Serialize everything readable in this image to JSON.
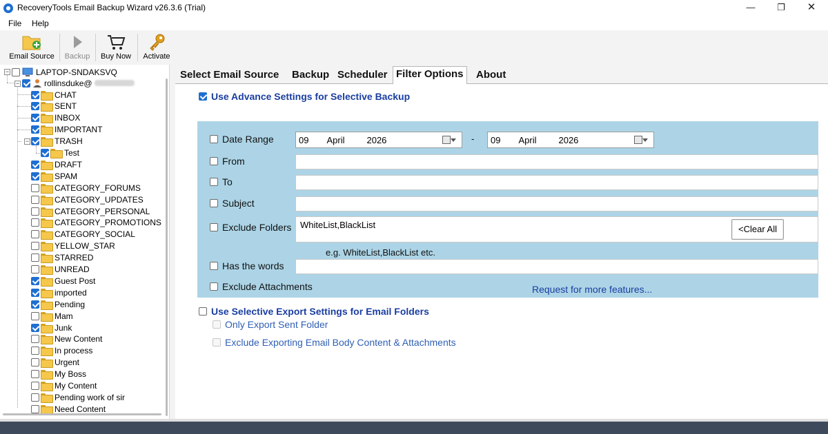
{
  "window": {
    "title": "RecoveryTools Email Backup Wizard v26.3.6 (Trial)",
    "min": "—",
    "max": "❐",
    "close": "✕"
  },
  "menu": {
    "file": "File",
    "help": "Help"
  },
  "toolbar": {
    "email_source": "Email Source",
    "backup": "Backup",
    "buy_now": "Buy Now",
    "activate": "Activate"
  },
  "tree": {
    "root": "LAPTOP-SNDAKSVQ",
    "account": "rollinsduke@",
    "folders": [
      {
        "label": "CHAT",
        "checked": true
      },
      {
        "label": "SENT",
        "checked": true
      },
      {
        "label": "INBOX",
        "checked": true
      },
      {
        "label": "IMPORTANT",
        "checked": true
      },
      {
        "label": "TRASH",
        "checked": true
      },
      {
        "label": "Test",
        "checked": true
      },
      {
        "label": "DRAFT",
        "checked": true
      },
      {
        "label": "SPAM",
        "checked": true
      },
      {
        "label": "CATEGORY_FORUMS",
        "checked": false
      },
      {
        "label": "CATEGORY_UPDATES",
        "checked": false
      },
      {
        "label": "CATEGORY_PERSONAL",
        "checked": false
      },
      {
        "label": "CATEGORY_PROMOTIONS",
        "checked": false
      },
      {
        "label": "CATEGORY_SOCIAL",
        "checked": false
      },
      {
        "label": "YELLOW_STAR",
        "checked": false
      },
      {
        "label": "STARRED",
        "checked": false
      },
      {
        "label": "UNREAD",
        "checked": false
      },
      {
        "label": "Guest Post",
        "checked": true
      },
      {
        "label": "imported",
        "checked": true
      },
      {
        "label": "Pending",
        "checked": true
      },
      {
        "label": "Mam",
        "checked": false
      },
      {
        "label": "Junk",
        "checked": true
      },
      {
        "label": "New Content",
        "checked": false
      },
      {
        "label": "In process",
        "checked": false
      },
      {
        "label": "Urgent",
        "checked": false
      },
      {
        "label": "My Boss",
        "checked": false
      },
      {
        "label": "My Content",
        "checked": false
      },
      {
        "label": "Pending work of sir",
        "checked": false
      },
      {
        "label": "Need Content",
        "checked": false
      }
    ]
  },
  "tabs": [
    "Select Email Source",
    "Backup",
    "Scheduler",
    "Filter Options",
    "About"
  ],
  "filter": {
    "advance_title": "Use Advance Settings for Selective Backup",
    "date_range": "Date Range",
    "date_from": {
      "day": "09",
      "month": "April",
      "year": "2026"
    },
    "date_sep": "-",
    "date_to": {
      "day": "09",
      "month": "April",
      "year": "2026"
    },
    "from": "From",
    "to": "To",
    "subject": "Subject",
    "exclude_folders": "Exclude Folders",
    "exclude_folders_value": "WhiteList,BlackList",
    "clear_all": "<Clear All",
    "example": "e.g. WhiteList,BlackList etc.",
    "has_words": "Has the words",
    "exclude_attachments": "Exclude Attachments",
    "request_link": "Request for more features...",
    "export_title": "Use Selective Export Settings for Email Folders",
    "only_sent": "Only Export Sent Folder",
    "exclude_body": "Exclude Exporting Email Body Content & Attachments"
  }
}
